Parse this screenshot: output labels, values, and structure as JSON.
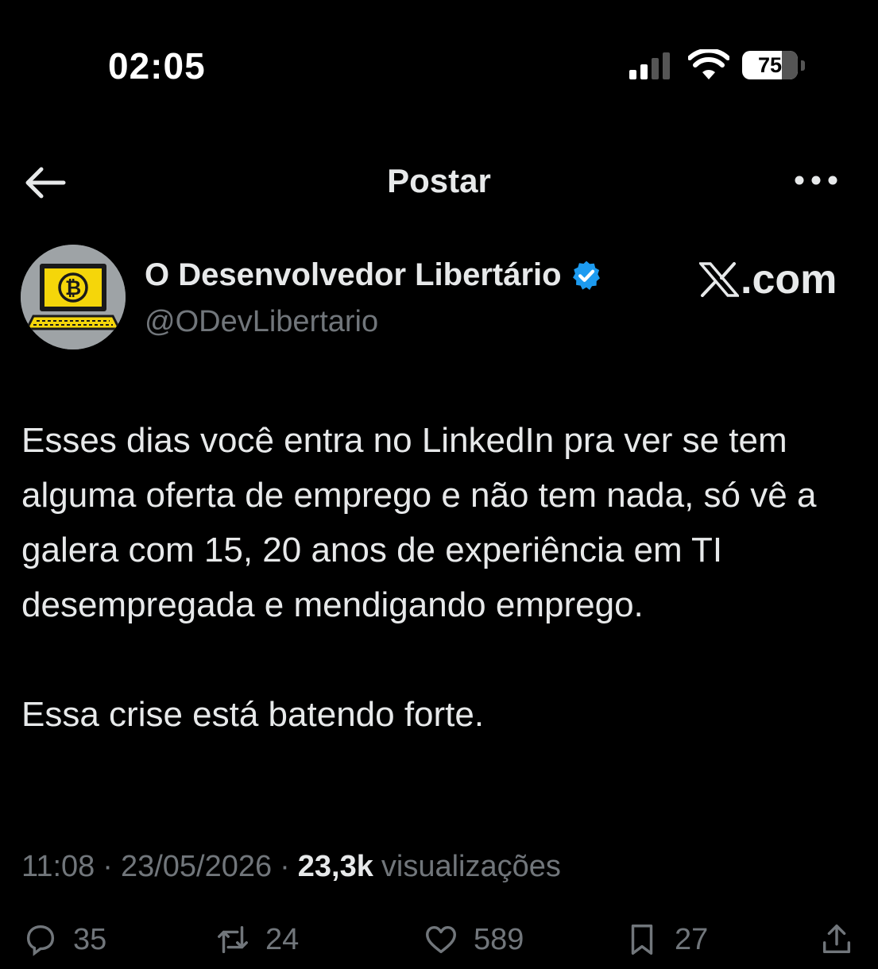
{
  "status_bar": {
    "time": "02:05",
    "battery_level": "75",
    "battery_fraction": 0.75
  },
  "header": {
    "title": "Postar"
  },
  "author": {
    "name": "O Desenvolvedor Libertário",
    "handle": "@ODevLibertario",
    "verified": true,
    "avatar_icon": "bitcoin-laptop-icon"
  },
  "watermark": {
    "text": ".com",
    "icon": "x-logo-icon"
  },
  "post": {
    "paragraphs": [
      "Esses dias você entra no LinkedIn pra ver se tem alguma oferta de emprego e não tem nada, só vê a galera com 15, 20 anos de experiência em TI desempregada e mendigando emprego.",
      "Essa crise está batendo forte."
    ],
    "time": "11:08",
    "separator": "·",
    "date": "23/05/2026",
    "views_count": "23,3k",
    "views_label": "visualizações"
  },
  "actions": {
    "replies": "35",
    "reposts": "24",
    "likes": "589",
    "bookmarks": "27"
  },
  "colors": {
    "background": "#000000",
    "text": "#e7e9ea",
    "muted": "#71767b",
    "verified": "#1d9bf0"
  }
}
